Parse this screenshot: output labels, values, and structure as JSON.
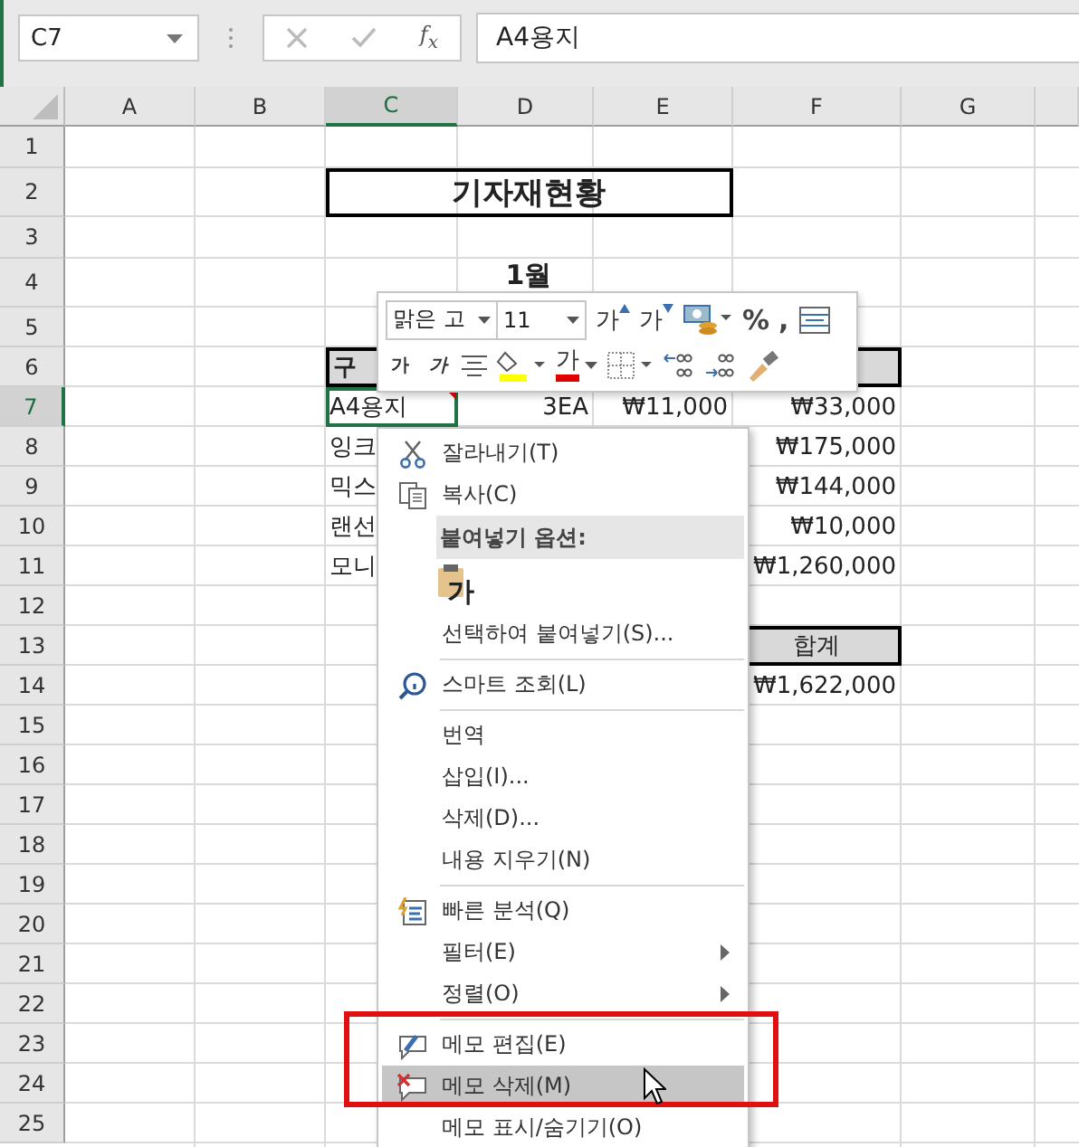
{
  "formula_bar": {
    "name_box": "C7",
    "function_label": "f$_{x}$",
    "formula": "A4용지"
  },
  "columns": [
    {
      "label": "A",
      "selected": false
    },
    {
      "label": "B",
      "selected": false
    },
    {
      "label": "C",
      "selected": true
    },
    {
      "label": "D",
      "selected": false
    },
    {
      "label": "E",
      "selected": false
    },
    {
      "label": "F",
      "selected": false
    },
    {
      "label": "G",
      "selected": false
    }
  ],
  "rows": [
    {
      "number": "1",
      "selected": false
    },
    {
      "number": "2",
      "selected": false,
      "cells": [
        {
          "kind": "blank"
        },
        {
          "kind": "blank"
        },
        {
          "kind": "title",
          "text": "기자재현황",
          "selected": false
        }
      ]
    },
    {
      "number": "3",
      "selected": false
    },
    {
      "number": "4",
      "selected": false,
      "cells": [
        {
          "kind": "blank"
        },
        {
          "kind": "blank"
        },
        {
          "kind": "subtitle",
          "text": "1월",
          "selected": false
        }
      ]
    },
    {
      "number": "5",
      "selected": false
    },
    {
      "number": "6",
      "selected": false,
      "cells": [
        {
          "kind": "blank"
        },
        {
          "kind": "blank"
        },
        {
          "kind": "header",
          "text": "구",
          "selected": false
        }
      ]
    },
    {
      "number": "7",
      "selected": true,
      "cells": [
        {
          "kind": "blank"
        },
        {
          "kind": "blank"
        },
        {
          "kind": "text",
          "text": "A4용지",
          "selected": true,
          "comment": true
        },
        {
          "kind": "number",
          "text": "3EA",
          "selected": false
        },
        {
          "kind": "number",
          "text": "₩11,000",
          "selected": false
        },
        {
          "kind": "number",
          "text": "₩33,000",
          "selected": false
        }
      ]
    },
    {
      "number": "8",
      "selected": false,
      "cells": [
        {
          "kind": "blank"
        },
        {
          "kind": "blank"
        },
        {
          "kind": "text",
          "text": "잉크",
          "selected": false
        },
        {
          "kind": "blank"
        },
        {
          "kind": "blank"
        },
        {
          "kind": "number",
          "text": "₩175,000",
          "selected": false
        }
      ]
    },
    {
      "number": "9",
      "selected": false,
      "cells": [
        {
          "kind": "blank"
        },
        {
          "kind": "blank"
        },
        {
          "kind": "text",
          "text": "믹스",
          "selected": false
        },
        {
          "kind": "blank"
        },
        {
          "kind": "blank"
        },
        {
          "kind": "number",
          "text": "₩144,000",
          "selected": false
        }
      ]
    },
    {
      "number": "10",
      "selected": false,
      "cells": [
        {
          "kind": "blank"
        },
        {
          "kind": "blank"
        },
        {
          "kind": "text",
          "text": "랜선",
          "selected": false
        },
        {
          "kind": "blank"
        },
        {
          "kind": "blank"
        },
        {
          "kind": "number",
          "text": "₩10,000",
          "selected": false
        }
      ]
    },
    {
      "number": "11",
      "selected": false,
      "cells": [
        {
          "kind": "blank"
        },
        {
          "kind": "blank"
        },
        {
          "kind": "text",
          "text": "모니",
          "selected": false
        },
        {
          "kind": "blank"
        },
        {
          "kind": "blank"
        },
        {
          "kind": "number",
          "text": "₩1,260,000",
          "selected": false
        }
      ]
    },
    {
      "number": "12",
      "selected": false
    },
    {
      "number": "13",
      "selected": false,
      "cells": [
        {
          "kind": "blank"
        },
        {
          "kind": "blank"
        },
        {
          "kind": "blank"
        },
        {
          "kind": "blank"
        },
        {
          "kind": "blank"
        },
        {
          "kind": "total",
          "text": "합계",
          "selected": false
        }
      ]
    },
    {
      "number": "14",
      "selected": false,
      "cells": [
        {
          "kind": "blank"
        },
        {
          "kind": "blank"
        },
        {
          "kind": "blank"
        },
        {
          "kind": "blank"
        },
        {
          "kind": "blank"
        },
        {
          "kind": "number",
          "text": "₩1,622,000",
          "selected": false
        }
      ]
    },
    {
      "number": "15",
      "selected": false
    },
    {
      "number": "16",
      "selected": false
    },
    {
      "number": "17",
      "selected": false
    },
    {
      "number": "18",
      "selected": false
    },
    {
      "number": "19",
      "selected": false
    },
    {
      "number": "20",
      "selected": false
    },
    {
      "number": "21",
      "selected": false
    },
    {
      "number": "22",
      "selected": false
    },
    {
      "number": "23",
      "selected": false
    },
    {
      "number": "24",
      "selected": false
    },
    {
      "number": "25",
      "selected": false
    }
  ],
  "mini_toolbar": {
    "upper_controls": [
      {
        "kind": "font-select",
        "label": "맑은 고"
      },
      {
        "kind": "size-select",
        "label": "11"
      },
      {
        "kind": "grow",
        "label": "가"
      },
      {
        "kind": "shrink",
        "label": "가"
      },
      {
        "kind": "currency"
      },
      {
        "kind": "percent",
        "label": "%"
      },
      {
        "kind": "comma",
        "label": ","
      },
      {
        "kind": "wrap"
      }
    ],
    "lower_controls": [
      {
        "kind": "bold",
        "label": "가"
      },
      {
        "kind": "italic",
        "label": "가"
      },
      {
        "kind": "align"
      },
      {
        "kind": "fill-color",
        "color": "#ffff00"
      },
      {
        "kind": "font-color",
        "label": "가",
        "color": "#e00000"
      },
      {
        "kind": "borders"
      },
      {
        "kind": "add-decimal"
      },
      {
        "kind": "remove-decimal"
      },
      {
        "kind": "painter"
      }
    ]
  },
  "context_menu": [
    {
      "kind": "item",
      "label": "잘라내기(T)",
      "selected": false
    },
    {
      "kind": "item",
      "label": "복사(C)",
      "selected": false
    },
    {
      "kind": "header",
      "label": "붙여넣기 옵션:"
    },
    {
      "kind": "paste-option",
      "label": "가"
    },
    {
      "kind": "item",
      "label": "선택하여 붙여넣기(S)...",
      "selected": false
    },
    {
      "kind": "separator"
    },
    {
      "kind": "item",
      "label": "스마트 조회(L)",
      "selected": false
    },
    {
      "kind": "separator"
    },
    {
      "kind": "item",
      "label": "번역",
      "selected": false
    },
    {
      "kind": "item",
      "label": "삽입(I)...",
      "selected": false
    },
    {
      "kind": "item",
      "label": "삭제(D)...",
      "selected": false
    },
    {
      "kind": "item",
      "label": "내용 지우기(N)",
      "selected": false
    },
    {
      "kind": "separator"
    },
    {
      "kind": "item",
      "label": "빠른 분석(Q)",
      "selected": false
    },
    {
      "kind": "item",
      "label": "필터(E)",
      "selected": false,
      "submenu": true
    },
    {
      "kind": "item",
      "label": "정렬(O)",
      "selected": false,
      "submenu": true
    },
    {
      "kind": "separator"
    },
    {
      "kind": "item",
      "label": "메모 편집(E)",
      "selected": false
    },
    {
      "kind": "item",
      "label": "메모 삭제(M)",
      "selected": true
    },
    {
      "kind": "item",
      "label": "메모 표시/숨기기(O)",
      "selected": false
    }
  ],
  "annotation": {
    "kind": "highlight-box",
    "color": "#e01010"
  }
}
